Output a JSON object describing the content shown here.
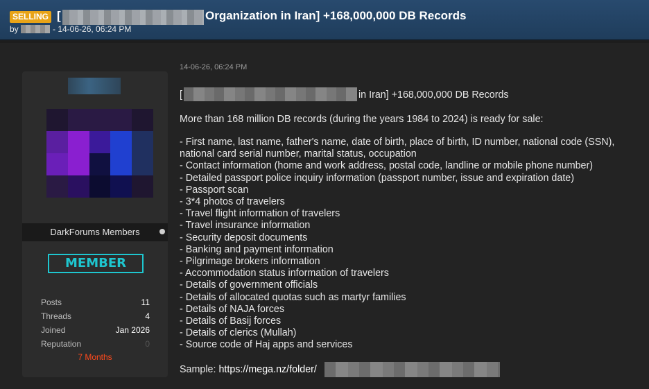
{
  "thread": {
    "badge": "SELLING",
    "title_prefix": "[",
    "title_suffix": "Organization in Iran] +168,000,000 DB Records",
    "byline_by": "by",
    "byline_date": "- 14-06-26, 06:24 PM"
  },
  "user": {
    "rank_name": "DarkForums Members",
    "badge_label": "MEMBER",
    "stats": [
      {
        "label": "Posts",
        "value": "11"
      },
      {
        "label": "Threads",
        "value": "4"
      },
      {
        "label": "Joined",
        "value": "Jan 2026"
      },
      {
        "label": "Reputation",
        "value": "0"
      }
    ],
    "membership_duration": "7 Months"
  },
  "post": {
    "date": "14-06-26, 06:24 PM",
    "title_prefix": "[",
    "title_suffix": "in Iran] +168,000,000 DB Records",
    "intro": "More than 168 million DB records (during the years 1984 to 2024) is ready for sale:",
    "items": [
      "- First name, last name, father's name, date of birth, place of birth, ID number, national code (SSN),",
      "national card serial number, marital status, occupation",
      "- Contact information (home and work address, postal code, landline or mobile phone number)",
      "- Detailed passport police inquiry information (passport number, issue and expiration date)",
      "- Passport scan",
      "- 3*4 photos of travelers",
      "- Travel flight information of travelers",
      "- Travel insurance information",
      "- Security deposit documents",
      "- Banking and payment information",
      "- Pilgrimage brokers information",
      "- Accommodation status information of travelers",
      "- Details of government officials",
      "- Details of allocated quotas such as martyr families",
      "- Details of NAJA forces",
      "- Details of Basij forces",
      "- Details of clerics (Mullah)",
      "- Source code of Haj apps and services"
    ],
    "sample_label": "Sample:",
    "sample_link": "https://mega.nz/folder/"
  },
  "colors": {
    "header": "#284a6e",
    "badge": "#e8a317",
    "member_badge": "#1ec6cf",
    "months": "#ff4a1c",
    "avatar_palette": [
      "#2a1a44",
      "#5a1fa0",
      "#8a1fd0",
      "#3b1a9a",
      "#2040d0",
      "#101040"
    ]
  }
}
